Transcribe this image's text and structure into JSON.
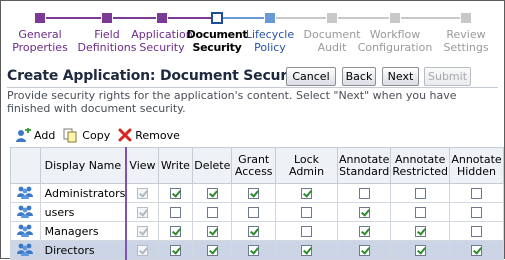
{
  "train": {
    "steps": [
      {
        "label": "General\nProperties",
        "state": "visited"
      },
      {
        "label": "Field\nDefinitions",
        "state": "visited"
      },
      {
        "label": "Application\nSecurity",
        "state": "visited"
      },
      {
        "label": "Document\nSecurity",
        "state": "current"
      },
      {
        "label": "Lifecycle\nPolicy",
        "state": "next"
      },
      {
        "label": "Document\nAudit",
        "state": "future"
      },
      {
        "label": "Workflow\nConfiguration",
        "state": "future"
      },
      {
        "label": "Review\nSettings",
        "state": "future"
      }
    ],
    "colors": {
      "visited": "#7a3a96",
      "current": "#1e4e9a",
      "next": "#6a9ad6",
      "future": "#c8c8c8"
    }
  },
  "header": {
    "title": "Create Application: Document Security",
    "buttons": {
      "cancel": "Cancel",
      "back": "Back",
      "next": "Next",
      "submit": "Submit"
    },
    "instructions": "Provide security rights for the application's content. Select \"Next\" when you have finished with document security."
  },
  "toolbar": {
    "add": "Add",
    "copy": "Copy",
    "remove": "Remove"
  },
  "table": {
    "columns": [
      "Display Name",
      "View",
      "Write",
      "Delete",
      "Grant\nAccess",
      "Lock Admin",
      "Annotate\nStandard",
      "Annotate\nRestricted",
      "Annotate\nHidden"
    ],
    "rows": [
      {
        "name": "Administrators",
        "checks": [
          true,
          true,
          true,
          true,
          true,
          false,
          false,
          false
        ],
        "selected": false
      },
      {
        "name": "users",
        "checks": [
          true,
          false,
          false,
          false,
          false,
          true,
          false,
          false
        ],
        "selected": false
      },
      {
        "name": "Managers",
        "checks": [
          true,
          true,
          true,
          true,
          false,
          true,
          true,
          false
        ],
        "selected": false
      },
      {
        "name": "Directors",
        "checks": [
          true,
          true,
          true,
          true,
          true,
          true,
          true,
          true
        ],
        "selected": true
      }
    ]
  }
}
